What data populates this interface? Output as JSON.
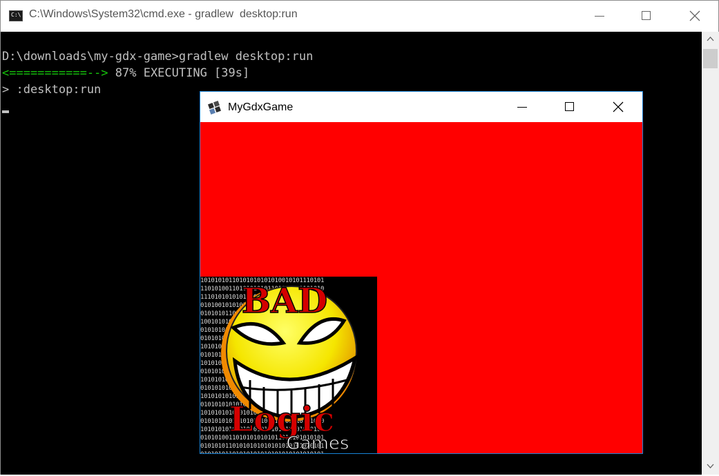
{
  "cmd_window": {
    "title": "C:\\Windows\\System32\\cmd.exe - gradlew  desktop:run",
    "icon": "cmd-icon",
    "icon_text": "C:\\",
    "controls": {
      "minimize": "minimize-icon",
      "maximize": "maximize-icon",
      "close": "close-icon"
    }
  },
  "console": {
    "line1": "D:\\downloads\\my-gdx-game>gradlew desktop:run",
    "progress_bar": "<===========-->",
    "progress_status": " 87% EXECUTING [39s]",
    "line3": "> :desktop:run",
    "text_color": "#c0c0c0",
    "progress_color": "#16c60c"
  },
  "game_window": {
    "title": "MyGdxGame",
    "icon": "libgdx-icon",
    "clear_color": "#ff0000",
    "logo": {
      "text_top": "BAD",
      "text_middle": "Logic",
      "text_bottom": "Games",
      "binary_rows": [
        "10101010110101010101010010101110101",
        "11010100110101010101101010101101010",
        "11101010101010101101010101010101011",
        "01010010101010101010101010101010010",
        "01010101101010101010101010100101010",
        "10010101010101010101010101001101010",
        "01010101101010101010101010101001001",
        "01010101010101010101010101010100101",
        "10101010101010101010101010101010101",
        "01010101010101010101010101010101010",
        "10101010101010101010101010101010101",
        "01010101010101010101010101010101010",
        "10101010101010101010101010101010101",
        "01010101010101010101010101010101010",
        "10101010101010101010101010101010101",
        "01010101010101010101010101010101010",
        "10101010101010101010101010101010101",
        "01010101010101010101010101010101010",
        "10101010101010101010101010101010101",
        "01010100110101010101011010101010101",
        "01010101101010101010101010101010101",
        "01010101101010101010101010101010101"
      ]
    }
  }
}
